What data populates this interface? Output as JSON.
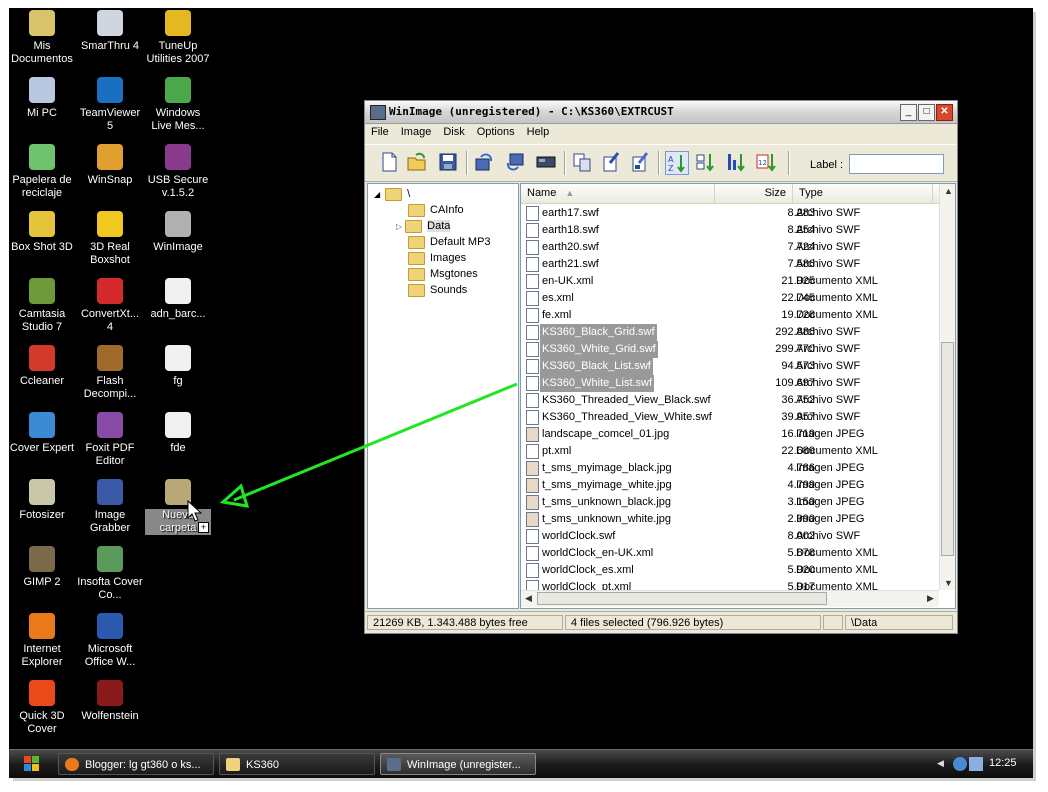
{
  "desktop": {
    "icons": [
      {
        "label": "Mis Documentos",
        "icon": "my-documents-icon",
        "color": "#d8c26a"
      },
      {
        "label": "SmarThru 4",
        "icon": "smarthru-icon",
        "color": "#cfd6e0"
      },
      {
        "label": "TuneUp Utilities 2007",
        "icon": "tuneup-icon",
        "color": "#e4b820"
      },
      {
        "label": "Mi PC",
        "icon": "my-computer-icon",
        "color": "#b8c8e0"
      },
      {
        "label": "TeamViewer 5",
        "icon": "teamviewer-icon",
        "color": "#1b6fc1"
      },
      {
        "label": "Windows Live Mes...",
        "icon": "windows-live-messenger-icon",
        "color": "#4aa84a"
      },
      {
        "label": "Papelera de reciclaje",
        "icon": "recycle-bin-icon",
        "color": "#6fc36f"
      },
      {
        "label": "WinSnap",
        "icon": "winsnap-icon",
        "color": "#e0a030"
      },
      {
        "label": "USB Secure v.1.5.2",
        "icon": "usb-secure-icon",
        "color": "#8a3a8a"
      },
      {
        "label": "Box Shot 3D",
        "icon": "boxshot-icon",
        "color": "#e6c43a"
      },
      {
        "label": "3D Real Boxshot",
        "icon": "real-boxshot-icon",
        "color": "#f0c820"
      },
      {
        "label": "WinImage",
        "icon": "winimage-icon",
        "color": "#b0b0b0"
      },
      {
        "label": "Camtasia Studio 7",
        "icon": "camtasia-icon",
        "color": "#6e9a3a"
      },
      {
        "label": "ConvertXt... 4",
        "icon": "convertx-icon",
        "color": "#d42a2a"
      },
      {
        "label": "adn_barc...",
        "icon": "file-icon",
        "color": "#f0f0f0"
      },
      {
        "label": "Ccleaner",
        "icon": "ccleaner-icon",
        "color": "#d43a2a"
      },
      {
        "label": "Flash Decompi...",
        "icon": "flash-decompiler-icon",
        "color": "#a06a2a"
      },
      {
        "label": "fg",
        "icon": "file-icon",
        "color": "#f0f0f0"
      },
      {
        "label": "Cover Expert",
        "icon": "cover-expert-icon",
        "color": "#3a8ad4"
      },
      {
        "label": "Foxit PDF Editor",
        "icon": "foxit-icon",
        "color": "#8a4aa8"
      },
      {
        "label": "fde",
        "icon": "file-icon",
        "color": "#f0f0f0"
      },
      {
        "label": "Fotosizer",
        "icon": "fotosizer-icon",
        "color": "#c8c8a8"
      },
      {
        "label": "Image Grabber",
        "icon": "image-grabber-icon",
        "color": "#3a5aa8"
      },
      {
        "label": "Nueva carpeta",
        "icon": "folder-icon",
        "color": "#b8a878",
        "selected": true
      },
      {
        "label": "GIMP 2",
        "icon": "gimp-icon",
        "color": "#7a6a4a"
      },
      {
        "label": "Insofta Cover Co...",
        "icon": "insofta-icon",
        "color": "#5a9a5a"
      },
      {
        "label": "Internet Explorer",
        "icon": "firefox-icon",
        "color": "#e87a1a"
      },
      {
        "label": "Microsoft Office W...",
        "icon": "word-icon",
        "color": "#2a5ab0"
      },
      {
        "label": "Quick 3D Cover",
        "icon": "quick3d-icon",
        "color": "#e84a1a"
      },
      {
        "label": "Wolfenstein",
        "icon": "wolfenstein-icon",
        "color": "#8a1a1a"
      }
    ]
  },
  "window": {
    "title": "WinImage (unregistered) - C:\\KS360\\EXTRCUST",
    "menu": [
      "File",
      "Image",
      "Disk",
      "Options",
      "Help"
    ],
    "label_caption": "Label :",
    "label_value": "",
    "tree": {
      "root": "\\",
      "folders": [
        "CAInfo",
        "Data",
        "Default MP3",
        "Images",
        "Msgtones",
        "Sounds"
      ],
      "selected": "Data"
    },
    "columns": {
      "name": "Name",
      "size": "Size",
      "type": "Type"
    },
    "files": [
      {
        "name": "earth17.swf",
        "size": "8.283",
        "type": "Archivo SWF",
        "selected": false
      },
      {
        "name": "earth18.swf",
        "size": "8.254",
        "type": "Archivo SWF",
        "selected": false
      },
      {
        "name": "earth20.swf",
        "size": "7.724",
        "type": "Archivo SWF",
        "selected": false
      },
      {
        "name": "earth21.swf",
        "size": "7.586",
        "type": "Archivo SWF",
        "selected": false
      },
      {
        "name": "en-UK.xml",
        "size": "21.925",
        "type": "Documento XML",
        "selected": false
      },
      {
        "name": "es.xml",
        "size": "22.745",
        "type": "Documento XML",
        "selected": false
      },
      {
        "name": "fe.xml",
        "size": "19.728",
        "type": "Documento XML",
        "selected": false
      },
      {
        "name": "KS360_Black_Grid.swf",
        "size": "292.886",
        "type": "Archivo SWF",
        "selected": true
      },
      {
        "name": "KS360_White_Grid.swf",
        "size": "299.770",
        "type": "Archivo SWF",
        "selected": true
      },
      {
        "name": "KS360_Black_List.swf",
        "size": "94.573",
        "type": "Archivo SWF",
        "selected": true
      },
      {
        "name": "KS360_White_List.swf",
        "size": "109.697",
        "type": "Archivo SWF",
        "selected": true
      },
      {
        "name": "KS360_Threaded_View_Black.swf",
        "size": "36.752",
        "type": "Archivo SWF",
        "selected": false
      },
      {
        "name": "KS360_Threaded_View_White.swf",
        "size": "39.957",
        "type": "Archivo SWF",
        "selected": false
      },
      {
        "name": "landscape_comcel_01.jpg",
        "size": "16.719",
        "type": "Imagen JPEG",
        "selected": false
      },
      {
        "name": "pt.xml",
        "size": "22.689",
        "type": "Documento XML",
        "selected": false
      },
      {
        "name": "t_sms_myimage_black.jpg",
        "size": "4.786",
        "type": "Imagen JPEG",
        "selected": false
      },
      {
        "name": "t_sms_myimage_white.jpg",
        "size": "4.799",
        "type": "Imagen JPEG",
        "selected": false
      },
      {
        "name": "t_sms_unknown_black.jpg",
        "size": "3.150",
        "type": "Imagen JPEG",
        "selected": false
      },
      {
        "name": "t_sms_unknown_white.jpg",
        "size": "2.990",
        "type": "Imagen JPEG",
        "selected": false
      },
      {
        "name": "worldClock.swf",
        "size": "8.002",
        "type": "Archivo SWF",
        "selected": false
      },
      {
        "name": "worldClock_en-UK.xml",
        "size": "5.878",
        "type": "Documento XML",
        "selected": false
      },
      {
        "name": "worldClock_es.xml",
        "size": "5.920",
        "type": "Documento XML",
        "selected": false
      },
      {
        "name": "worldClock_pt.xml",
        "size": "5.917",
        "type": "Documento XML",
        "selected": false
      }
    ],
    "status": {
      "free": "21269 KB, 1.343.488 bytes free",
      "selection": "4 files selected (796.926 bytes)",
      "path": "\\Data"
    }
  },
  "taskbar": {
    "tasks": [
      {
        "label": "Blogger: lg gt360 o ks...",
        "icon": "firefox-icon",
        "active": false
      },
      {
        "label": "KS360",
        "icon": "folder-icon",
        "active": false
      },
      {
        "label": "WinImage (unregister...",
        "icon": "winimage-icon",
        "active": true
      }
    ],
    "clock": "12:25"
  },
  "colors": {
    "accent_arrow": "#22e622",
    "selection": "#999999",
    "desktop": "#000000"
  }
}
